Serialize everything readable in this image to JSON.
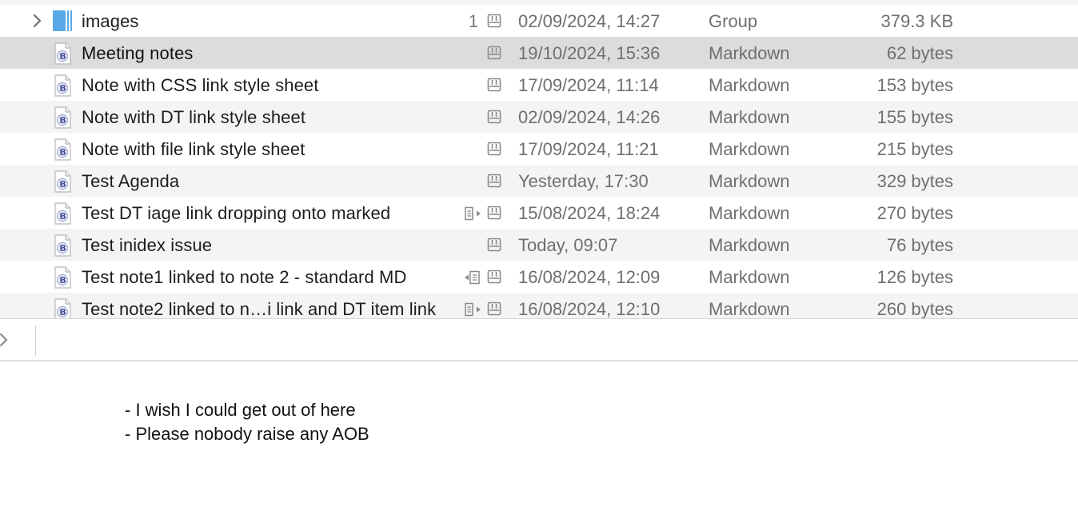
{
  "files": [
    {
      "name": "images",
      "type": "group",
      "count": "1",
      "has_link_icon": false,
      "date": "02/09/2024, 14:27",
      "kind": "Group",
      "size": "379.3 KB",
      "selected": false,
      "alt": false
    },
    {
      "name": "Meeting notes",
      "type": "markdown",
      "count": "",
      "has_link_icon": false,
      "date": "19/10/2024, 15:36",
      "kind": "Markdown",
      "size": "62 bytes",
      "selected": true,
      "alt": false
    },
    {
      "name": "Note with CSS link style sheet",
      "type": "markdown",
      "count": "",
      "has_link_icon": false,
      "date": "17/09/2024, 11:14",
      "kind": "Markdown",
      "size": "153 bytes",
      "selected": false,
      "alt": false
    },
    {
      "name": "Note with DT link style sheet",
      "type": "markdown",
      "count": "",
      "has_link_icon": false,
      "date": "02/09/2024, 14:26",
      "kind": "Markdown",
      "size": "155 bytes",
      "selected": false,
      "alt": true
    },
    {
      "name": "Note with file link style sheet",
      "type": "markdown",
      "count": "",
      "has_link_icon": false,
      "date": "17/09/2024, 11:21",
      "kind": "Markdown",
      "size": "215 bytes",
      "selected": false,
      "alt": false
    },
    {
      "name": "Test Agenda",
      "type": "markdown",
      "count": "",
      "has_link_icon": false,
      "date": "Yesterday, 17:30",
      "kind": "Markdown",
      "size": "329 bytes",
      "selected": false,
      "alt": true
    },
    {
      "name": "Test DT iage link dropping onto marked",
      "type": "markdown",
      "count": "",
      "has_link_icon": true,
      "link_icon": "outgoing-link-icon",
      "date": "15/08/2024, 18:24",
      "kind": "Markdown",
      "size": "270 bytes",
      "selected": false,
      "alt": false
    },
    {
      "name": "Test inidex issue",
      "type": "markdown",
      "count": "",
      "has_link_icon": false,
      "date": "Today, 09:07",
      "kind": "Markdown",
      "size": "76 bytes",
      "selected": false,
      "alt": true
    },
    {
      "name": "Test note1 linked to note 2 - standard MD",
      "type": "markdown",
      "count": "",
      "has_link_icon": true,
      "link_icon": "incoming-link-icon",
      "date": "16/08/2024, 12:09",
      "kind": "Markdown",
      "size": "126 bytes",
      "selected": false,
      "alt": false
    },
    {
      "name": "Test note2 linked to n…i link and DT item link",
      "type": "markdown",
      "count": "",
      "has_link_icon": true,
      "link_icon": "outgoing-link-icon",
      "date": "16/08/2024, 12:10",
      "kind": "Markdown",
      "size": "260 bytes",
      "selected": false,
      "alt": true
    }
  ],
  "preview": {
    "lines": [
      "- I wish I could get out of here",
      "- Please nobody raise any AOB"
    ]
  },
  "colors": {
    "selected_row": "#dcdcdc",
    "alt_row": "#f4f4f4",
    "group_folder": "#5aa9e6",
    "secondary_text": "#6f6f6f"
  }
}
